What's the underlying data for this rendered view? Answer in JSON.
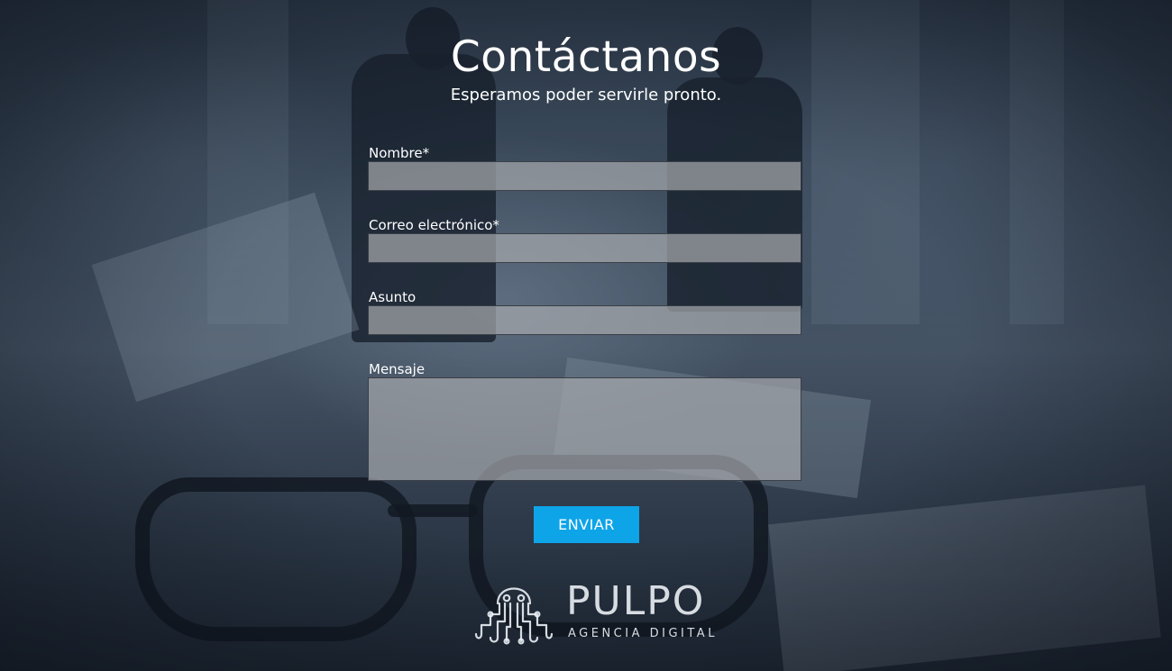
{
  "header": {
    "title": "Contáctanos",
    "subtitle": "Esperamos poder servirle pronto."
  },
  "form": {
    "name_label": "Nombre*",
    "name_value": "",
    "email_label": "Correo electrónico*",
    "email_value": "",
    "subject_label": "Asunto",
    "subject_value": "",
    "message_label": "Mensaje",
    "message_value": "",
    "submit_label": "ENVIAR"
  },
  "footer": {
    "logo_name": "PULPO",
    "logo_tagline": "AGENCIA DIGITAL",
    "logo_icon": "octopus-circuit-icon"
  },
  "colors": {
    "accent": "#0ea4e8",
    "input_bg": "#a5a8ac",
    "text": "#ffffff"
  }
}
